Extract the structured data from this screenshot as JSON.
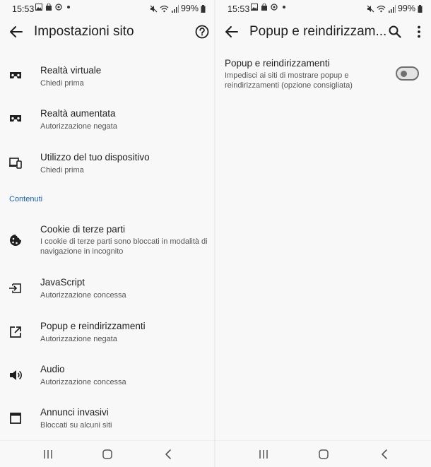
{
  "status_bar": {
    "time": "15:53",
    "battery": "99%"
  },
  "left": {
    "title": "Impostazioni sito",
    "items": [
      {
        "title": "Realtà virtuale",
        "subtitle": "Chiedi prima",
        "icon": "vr-headset-icon"
      },
      {
        "title": "Realtà aumentata",
        "subtitle": "Autorizzazione negata",
        "icon": "vr-headset-icon"
      },
      {
        "title": "Utilizzo del tuo dispositivo",
        "subtitle": "Chiedi prima",
        "icon": "devices-icon"
      }
    ],
    "section_label": "Contenuti",
    "content_items": [
      {
        "title": "Cookie di terze parti",
        "subtitle": "I cookie di terze parti sono bloccati in modalità di navigazione in incognito",
        "icon": "cookie-icon"
      },
      {
        "title": "JavaScript",
        "subtitle": "Autorizzazione concessa",
        "icon": "javascript-icon"
      },
      {
        "title": "Popup e reindirizzamenti",
        "subtitle": "Autorizzazione negata",
        "icon": "open-in-new-icon"
      },
      {
        "title": "Audio",
        "subtitle": "Autorizzazione concessa",
        "icon": "speaker-icon"
      },
      {
        "title": "Annunci invasivi",
        "subtitle": "Bloccati su alcuni siti",
        "icon": "window-icon"
      }
    ]
  },
  "right": {
    "title": "Popup e reindirizzam...",
    "setting": {
      "title": "Popup e reindirizzamenti",
      "description": "Impedisci ai siti di mostrare popup e reindirizzamenti (opzione consigliata)",
      "enabled": false
    }
  }
}
